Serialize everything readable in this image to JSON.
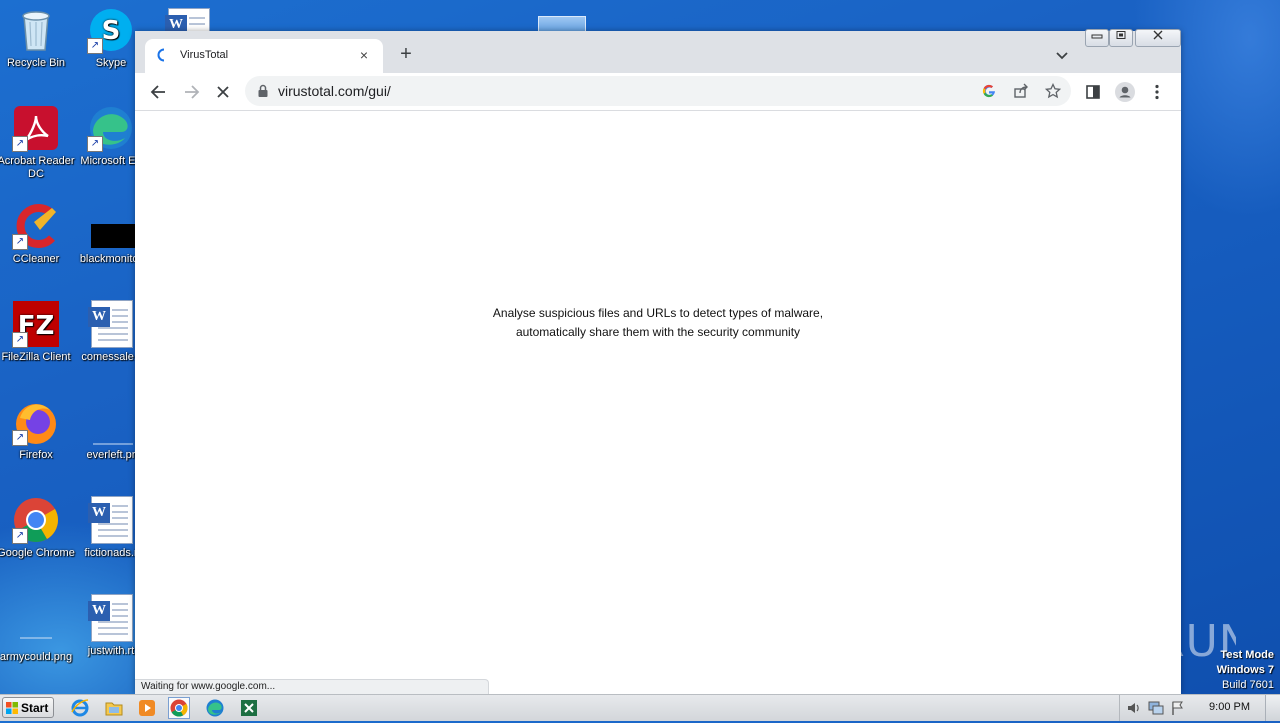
{
  "desktop": {
    "icons": [
      {
        "label": "Recycle Bin"
      },
      {
        "label": "Skype"
      },
      {
        "label": "Acrobat Reader DC"
      },
      {
        "label": "Microsoft Ed"
      },
      {
        "label": "CCleaner"
      },
      {
        "label": "blackmonitor"
      },
      {
        "label": "FileZilla Client"
      },
      {
        "label": "comessale.r"
      },
      {
        "label": "Firefox"
      },
      {
        "label": "everleft.pr"
      },
      {
        "label": "Google Chrome"
      },
      {
        "label": "fictionads.r"
      },
      {
        "label": "armycould.png"
      },
      {
        "label": "justwith.rt"
      }
    ]
  },
  "browser": {
    "tab": {
      "title": "VirusTotal",
      "close": "×"
    },
    "new_tab": "+",
    "window_buttons": {
      "minimize": "▭",
      "restore": "▣",
      "close": "✕"
    },
    "address": {
      "url": "virustotal.com/gui/"
    },
    "page": {
      "tagline_line1": "Analyse suspicious files and URLs to detect types of malware,",
      "tagline_line2": "automatically share them with the security community"
    },
    "status_bar": "Waiting for www.google.com..."
  },
  "watermark": {
    "brand": "ANY RUN",
    "test_mode": "Test Mode",
    "os": "Windows 7",
    "build": "Build 7601"
  },
  "taskbar": {
    "start_label": "Start",
    "clock": "9:00 PM"
  },
  "colors": {
    "desktop_blue": "#1a62c4",
    "chrome_frame": "#dee1e6",
    "omnibox": "#f1f3f4"
  }
}
